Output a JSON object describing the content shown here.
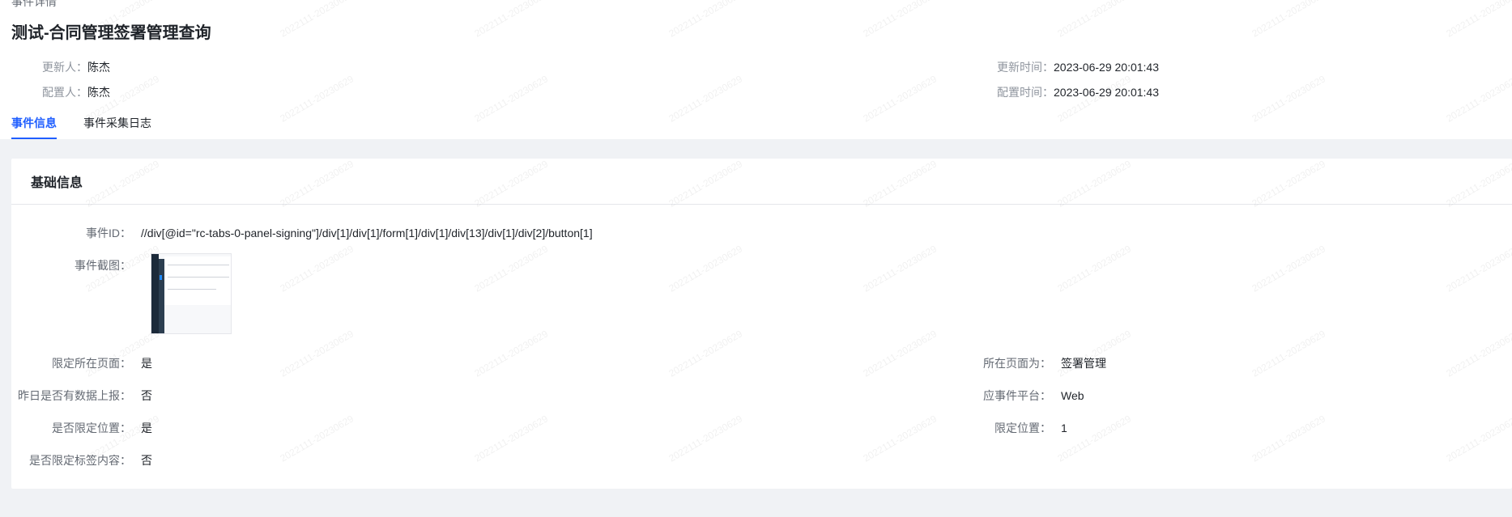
{
  "breadcrumb": "事件详情",
  "header": {
    "title": "测试-合同管理签署管理查询",
    "updater_label": "更新人：",
    "updater": "陈杰",
    "configurer_label": "配置人：",
    "configurer": "陈杰",
    "updated_time_label": "更新时间：",
    "updated_time": "2023-06-29 20:01:43",
    "configured_time_label": "配置时间：",
    "configured_time": "2023-06-29 20:01:43"
  },
  "tabs": [
    {
      "label": "事件信息",
      "active": true
    },
    {
      "label": "事件采集日志",
      "active": false
    }
  ],
  "card": {
    "title": "基础信息",
    "event_id_label": "事件ID：",
    "event_id": "//div[@id=\"rc-tabs-0-panel-signing\"]/div[1]/div[1]/form[1]/div[1]/div[13]/div[1]/div[2]/button[1]",
    "screenshot_label": "事件截图：",
    "left_fields": [
      {
        "label": "限定所在页面：",
        "value": "是"
      },
      {
        "label": "昨日是否有数据上报：",
        "value": "否"
      },
      {
        "label": "是否限定位置：",
        "value": "是"
      },
      {
        "label": "是否限定标签内容：",
        "value": "否"
      }
    ],
    "right_fields": [
      {
        "label": "所在页面为：",
        "value": "签署管理"
      },
      {
        "label": "应事件平台：",
        "value": "Web"
      },
      {
        "label": "限定位置：",
        "value": "1"
      }
    ]
  },
  "watermark": "2022111-20230629",
  "colors": {
    "accent": "#1f5eff",
    "background": "#f0f2f5"
  }
}
